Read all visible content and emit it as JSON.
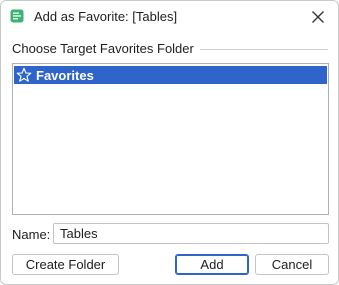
{
  "window": {
    "title": "Add as Favorite: [Tables]",
    "icons": {
      "app": "database-table-icon",
      "close": "close-icon"
    }
  },
  "folder_group": {
    "label": "Choose Target Favorites Folder",
    "tree": {
      "items": [
        {
          "label": "Favorites",
          "icon": "star-icon",
          "selected": true
        }
      ]
    }
  },
  "name_field": {
    "label": "Name:",
    "value": "Tables"
  },
  "buttons": {
    "create_folder": "Create Folder",
    "add": "Add",
    "cancel": "Cancel"
  },
  "colors": {
    "selection": "#2f65ca",
    "app_icon": "#3bb371",
    "default_button_border": "#2f65ca"
  }
}
